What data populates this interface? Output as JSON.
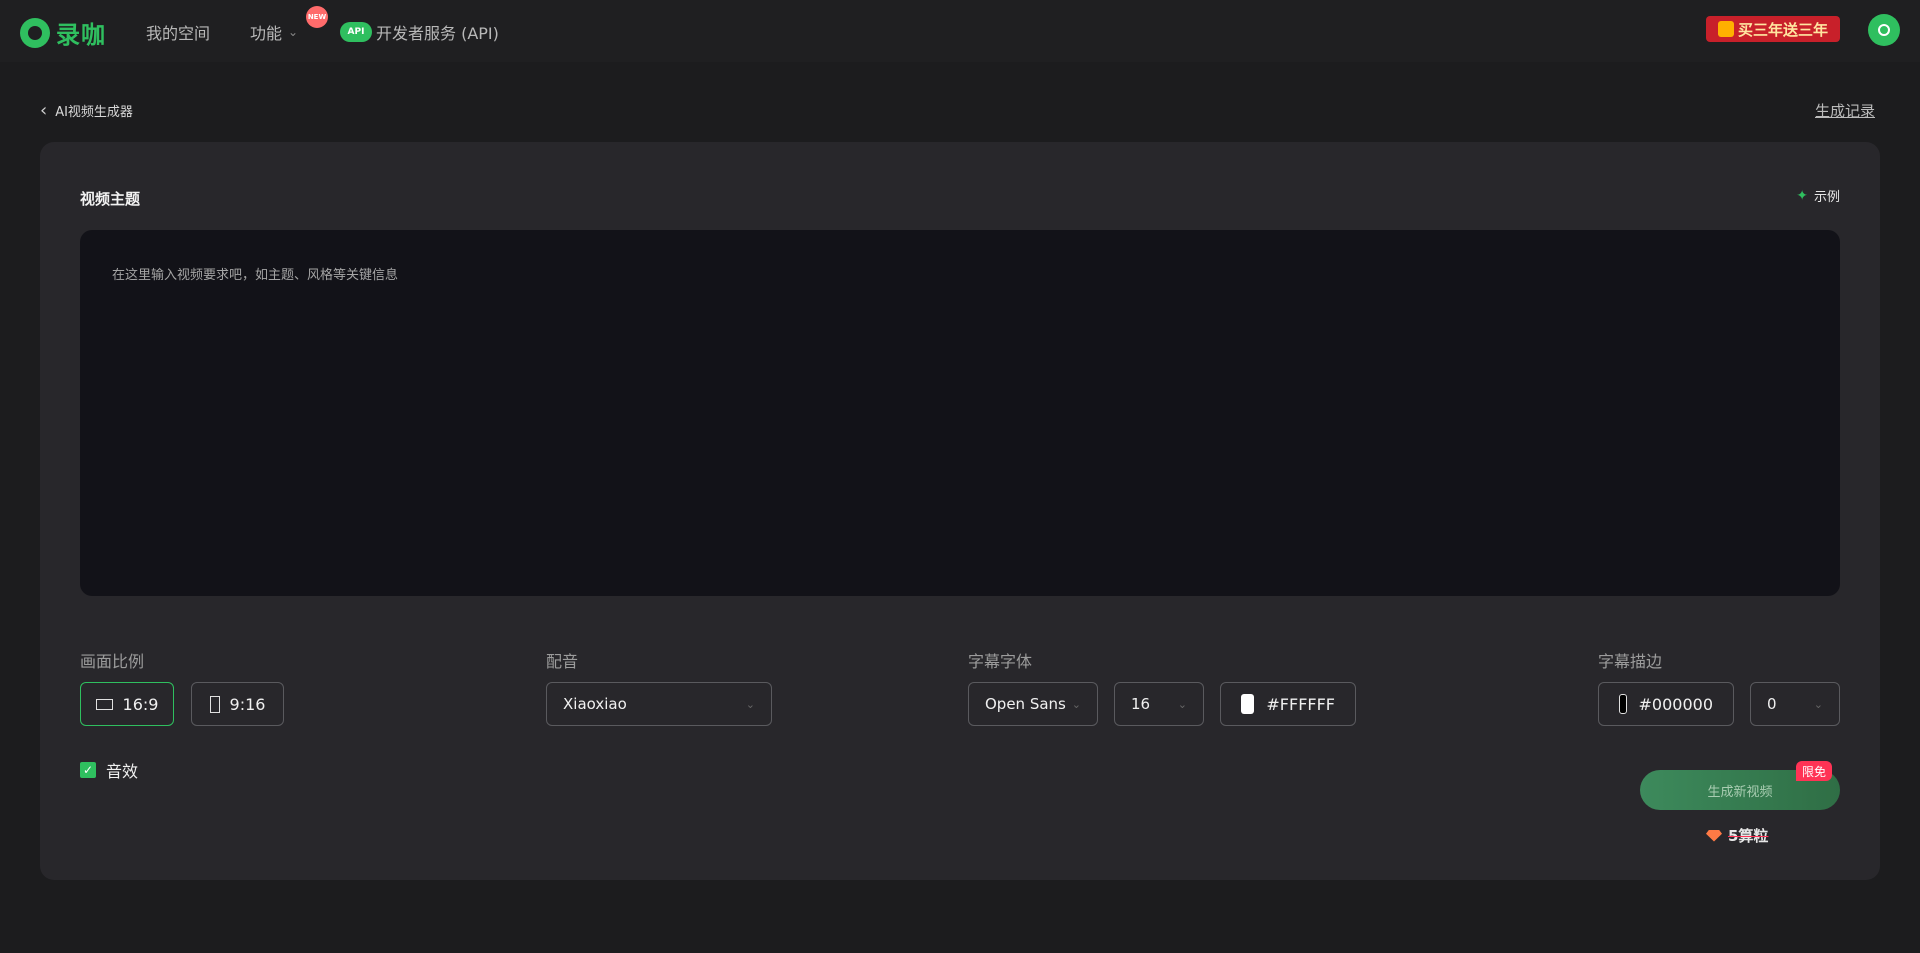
{
  "app": {
    "name": "录咖"
  },
  "nav": {
    "space": "我的空间",
    "features": "功能",
    "new_badge": "NEW",
    "api_badge": "API",
    "api": "开发者服务 (API)"
  },
  "promo": {
    "text": "买三年送三年"
  },
  "page": {
    "back_label": "AI视频生成器",
    "history_label": "生成记录"
  },
  "topic": {
    "title": "视频主题",
    "example_label": "示例",
    "placeholder": "在这里输入视频要求吧，如主题、风格等关键信息"
  },
  "ratio": {
    "label": "画面比例",
    "options": [
      "16:9",
      "9:16"
    ],
    "selected": "16:9"
  },
  "voice": {
    "label": "配音",
    "value": "Xiaoxiao"
  },
  "subtitle_font": {
    "label": "字幕字体",
    "font": "Open Sans",
    "size": "16",
    "color": "#FFFFFF"
  },
  "subtitle_stroke": {
    "label": "字幕描边",
    "color": "#000000",
    "width": "0"
  },
  "sfx": {
    "label": "音效",
    "checked": true
  },
  "generate": {
    "button_label": "生成新视频",
    "free_badge": "限免",
    "cost": "5算粒"
  },
  "colors": {
    "accent": "#2fbf5f",
    "card": "#28272b",
    "background": "#1c1c1e"
  }
}
